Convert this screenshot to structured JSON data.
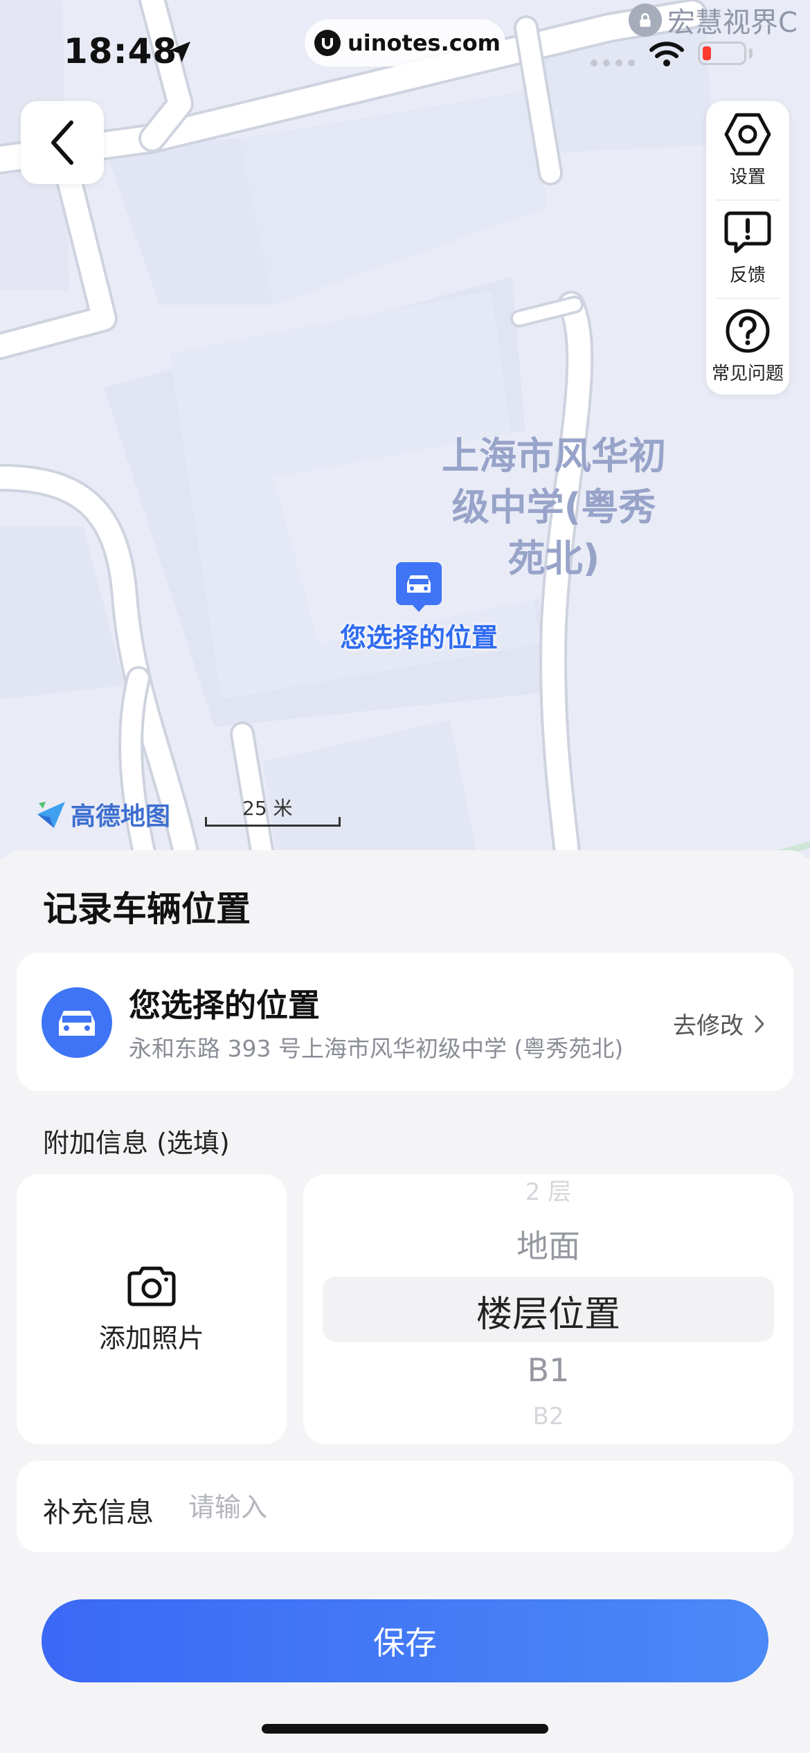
{
  "status": {
    "time": "18:48",
    "url": "uinotes.com",
    "watermark": "宏慧视界C"
  },
  "map": {
    "poi_label": "上海市风华初级中学(粤秀苑北)",
    "pin_label": "您选择的位置",
    "amap_brand": "高德地图",
    "scale": "25 米"
  },
  "tools": [
    {
      "label": "设置",
      "icon": "settings-hexagon-icon"
    },
    {
      "label": "反馈",
      "icon": "feedback-icon"
    },
    {
      "label": "常见问题",
      "icon": "question-icon"
    }
  ],
  "sheet": {
    "title": "记录车辆位置",
    "location": {
      "title": "您选择的位置",
      "address": "永和东路 393 号上海市风华初级中学 (粤秀苑北)",
      "edit": "去修改"
    },
    "extra_label": "附加信息 (选填)",
    "photo_label": "添加照片",
    "floor_picker": [
      "2 层",
      "地面",
      "楼层位置",
      "B1",
      "B2"
    ],
    "note": {
      "label": "补充信息",
      "placeholder": "请输入"
    },
    "save": "保存"
  },
  "colors": {
    "accent": "#3e74f5",
    "map_bg": "#e9ebf6",
    "poi": "#98a3c9"
  }
}
